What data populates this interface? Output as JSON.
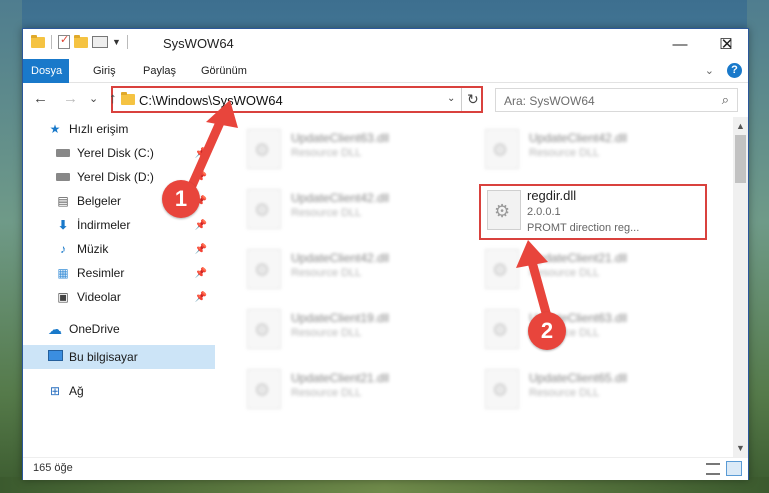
{
  "window": {
    "title": "SysWOW64",
    "controls": {
      "minimize": "—",
      "maximize": "☐",
      "close": "✕"
    }
  },
  "ribbon": {
    "tabs": [
      {
        "label": "Dosya",
        "active": true
      },
      {
        "label": "Giriş"
      },
      {
        "label": "Paylaş"
      },
      {
        "label": "Görünüm"
      }
    ],
    "help": "?"
  },
  "navigation": {
    "back": "←",
    "forward": "→",
    "recent": "⌄",
    "up": "↑",
    "address": "C:\\Windows\\SysWOW64",
    "address_dropdown": "⌄",
    "refresh": "↻",
    "search_placeholder": "Ara: SysWOW64"
  },
  "sidebar": {
    "items": [
      {
        "label": "Hızlı erişim",
        "icon": "star-icon"
      },
      {
        "label": "Yerel Disk (C:)",
        "icon": "disk-icon",
        "pinned": true
      },
      {
        "label": "Yerel Disk (D:)",
        "icon": "disk-icon",
        "pinned": true
      },
      {
        "label": "Belgeler",
        "icon": "document-icon",
        "pinned": true
      },
      {
        "label": "İndirmeler",
        "icon": "download-icon",
        "pinned": true
      },
      {
        "label": "Müzik",
        "icon": "music-icon",
        "pinned": true
      },
      {
        "label": "Resimler",
        "icon": "picture-icon",
        "pinned": true
      },
      {
        "label": "Videolar",
        "icon": "video-icon",
        "pinned": true
      },
      {
        "label": "OneDrive",
        "icon": "cloud-icon"
      },
      {
        "label": "Bu bilgisayar",
        "icon": "computer-icon",
        "selected": true
      },
      {
        "label": "Ağ",
        "icon": "network-icon"
      }
    ]
  },
  "files": [
    {
      "name": "UpdateClient63.dll",
      "desc": "Resource DLL"
    },
    {
      "name": "UpdateClient42.dll",
      "desc": "Resource DLL"
    },
    {
      "name": "UpdateClient42.dll",
      "desc": "Resource DLL"
    },
    {
      "name": "regdir.dll",
      "version": "2.0.0.1",
      "desc": "PROMT direction reg...",
      "highlighted": true
    },
    {
      "name": "UpdateClient42.dll",
      "desc": "Resource DLL"
    },
    {
      "name": "UpdateClient21.dll",
      "desc": "Resource DLL"
    },
    {
      "name": "UpdateClient19.dll",
      "desc": "Resource DLL"
    },
    {
      "name": "UpdateClient63.dll",
      "desc": "Resource DLL"
    },
    {
      "name": "UpdateClient21.dll",
      "desc": "Resource DLL"
    },
    {
      "name": "UpdateClient65.dll",
      "desc": "Resource DLL"
    }
  ],
  "status": {
    "count": "165 öğe"
  },
  "markers": [
    {
      "label": "1"
    },
    {
      "label": "2"
    }
  ],
  "colors": {
    "accent": "#1979ca",
    "highlight": "#d9413d",
    "marker": "#e8453c"
  }
}
